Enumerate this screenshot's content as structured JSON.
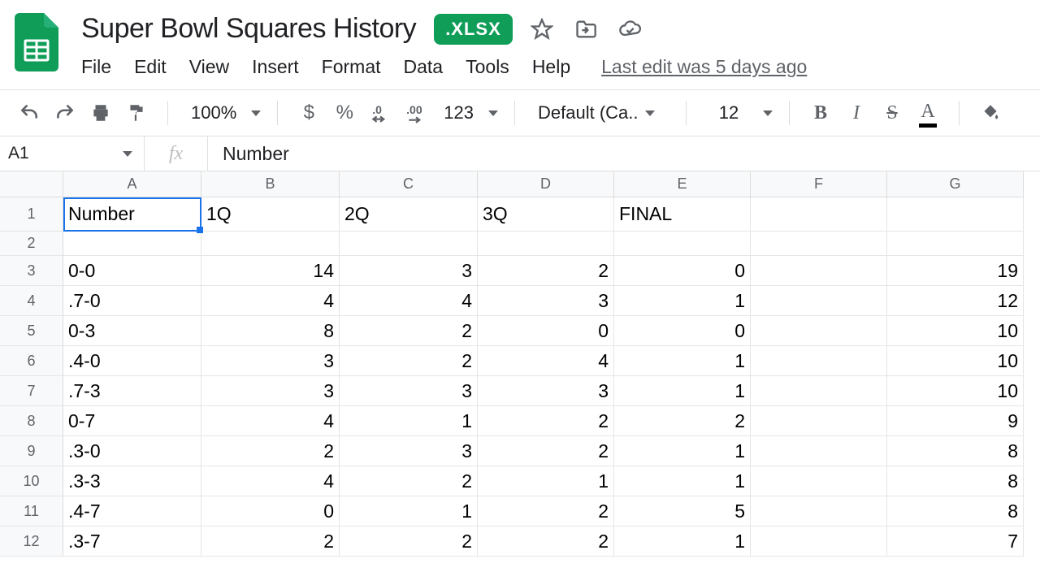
{
  "doc": {
    "title": "Super Bowl Squares History",
    "badge": ".XLSX",
    "last_edit": "Last edit was 5 days ago"
  },
  "menus": [
    "File",
    "Edit",
    "View",
    "Insert",
    "Format",
    "Data",
    "Tools",
    "Help"
  ],
  "toolbar": {
    "zoom": "100%",
    "num_format": "123",
    "font": "Default (Ca...",
    "font_size": "12"
  },
  "namebox": "A1",
  "fx_value": "Number",
  "columns": [
    "A",
    "B",
    "C",
    "D",
    "E",
    "F",
    "G"
  ],
  "headers_row": [
    "Number",
    "1Q",
    "2Q",
    "3Q",
    "FINAL",
    "",
    ""
  ],
  "row_numbers": [
    1,
    2,
    3,
    4,
    5,
    6,
    7,
    8,
    9,
    10,
    11,
    12
  ],
  "rows": [
    [
      "0-0",
      "14",
      "3",
      "2",
      "0",
      "",
      "19"
    ],
    [
      ".7-0",
      "4",
      "4",
      "3",
      "1",
      "",
      "12"
    ],
    [
      "0-3",
      "8",
      "2",
      "0",
      "0",
      "",
      "10"
    ],
    [
      ".4-0",
      "3",
      "2",
      "4",
      "1",
      "",
      "10"
    ],
    [
      ".7-3",
      "3",
      "3",
      "3",
      "1",
      "",
      "10"
    ],
    [
      "0-7",
      "4",
      "1",
      "2",
      "2",
      "",
      "9"
    ],
    [
      ".3-0",
      "2",
      "3",
      "2",
      "1",
      "",
      "8"
    ],
    [
      ".3-3",
      "4",
      "2",
      "1",
      "1",
      "",
      "8"
    ],
    [
      ".4-7",
      "0",
      "1",
      "2",
      "5",
      "",
      "8"
    ],
    [
      ".3-7",
      "2",
      "2",
      "2",
      "1",
      "",
      "7"
    ]
  ],
  "chart_data": {
    "type": "table",
    "title": "Super Bowl Squares History",
    "columns": [
      "Number",
      "1Q",
      "2Q",
      "3Q",
      "FINAL",
      "",
      "G"
    ],
    "rows": [
      [
        "0-0",
        14,
        3,
        2,
        0,
        null,
        19
      ],
      [
        ".7-0",
        4,
        4,
        3,
        1,
        null,
        12
      ],
      [
        "0-3",
        8,
        2,
        0,
        0,
        null,
        10
      ],
      [
        ".4-0",
        3,
        2,
        4,
        1,
        null,
        10
      ],
      [
        ".7-3",
        3,
        3,
        3,
        1,
        null,
        10
      ],
      [
        "0-7",
        4,
        1,
        2,
        2,
        null,
        9
      ],
      [
        ".3-0",
        2,
        3,
        2,
        1,
        null,
        8
      ],
      [
        ".3-3",
        4,
        2,
        1,
        1,
        null,
        8
      ],
      [
        ".4-7",
        0,
        1,
        2,
        5,
        null,
        8
      ],
      [
        ".3-7",
        2,
        2,
        2,
        1,
        null,
        7
      ]
    ]
  }
}
